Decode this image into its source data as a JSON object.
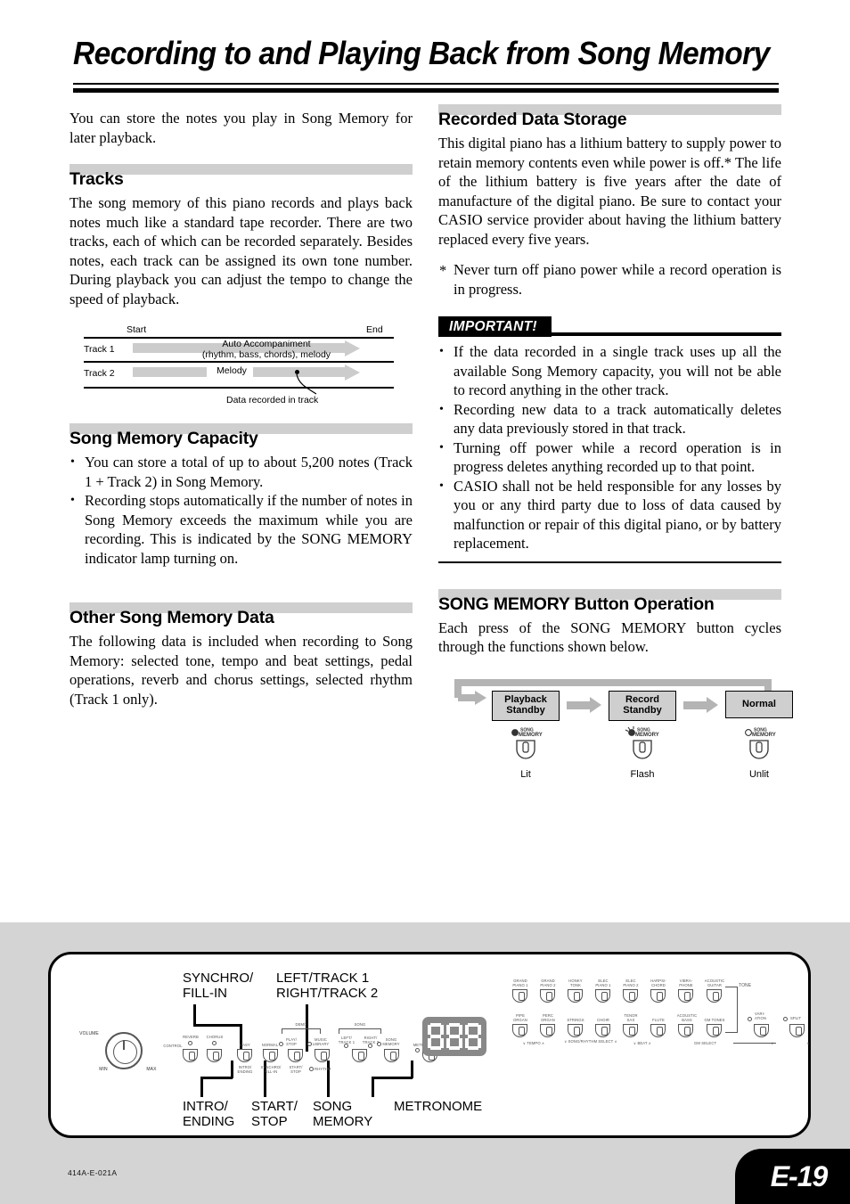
{
  "page": {
    "title": "Recording to and Playing Back from Song Memory",
    "footer_code": "414A-E-021A",
    "page_number": "E-19"
  },
  "intro": {
    "text": "You can store the notes you play in Song Memory for later playback."
  },
  "sections": {
    "tracks": {
      "heading": "Tracks",
      "body": "The song memory of this piano records and plays back notes much like a standard tape recorder. There are two tracks, each of which can be recorded separately. Besides notes, each track can be assigned its own tone number. During playback you can adjust the tempo to change the speed of playback."
    },
    "capacity": {
      "heading": "Song Memory Capacity",
      "bullets": [
        "You can store a total of up to about 5,200 notes (Track 1 + Track 2) in Song Memory.",
        "Recording stops automatically if the number of notes in Song Memory exceeds the maximum while you are recording. This is indicated by the SONG MEMORY indicator lamp turning on."
      ]
    },
    "other_data": {
      "heading": "Other Song Memory Data",
      "body": "The following data is included when recording to Song Memory: selected tone, tempo and beat settings, pedal operations, reverb and chorus settings, selected rhythm (Track 1 only)."
    },
    "storage": {
      "heading": "Recorded Data Storage",
      "body": "This digital piano has a lithium battery to supply power to retain memory contents even while power is off.* The life of the lithium battery is five years after the date of manufacture of the digital piano. Be sure to contact your CASIO service provider about having the lithium battery replaced every five years.",
      "footnote": "Never turn off piano power while a record operation is in progress."
    },
    "important": {
      "label": "IMPORTANT!",
      "bullets": [
        "If the data recorded in a single track uses up all the available Song Memory capacity, you will not be able to record anything in the other track.",
        "Recording new data to a track automatically deletes any data previously stored in that track.",
        "Turning off power while a record operation is in progress deletes anything recorded up to that point.",
        "CASIO shall not be held responsible for any losses by you or any third party due to loss of data caused by malfunction or repair of this digital piano, or by battery replacement."
      ]
    },
    "button_operation": {
      "heading": "SONG MEMORY Button Operation",
      "body": "Each press of the SONG MEMORY button cycles through the functions shown below."
    }
  },
  "track_diagram": {
    "start_label": "Start",
    "end_label": "End",
    "track1_label": "Track 1",
    "track2_label": "Track 2",
    "track1_content_line1": "Auto Accompaniment",
    "track1_content_line2": "(rhythm, bass, chords), melody",
    "track2_content": "Melody",
    "callout": "Data recorded in track"
  },
  "cycle_diagram": {
    "states": [
      {
        "line1": "Playback",
        "line2": "Standby",
        "lamp": "Lit",
        "button_label_line1": "SONG",
        "button_label_line2": "MEMORY"
      },
      {
        "line1": "Record",
        "line2": "Standby",
        "lamp": "Flash",
        "button_label_line1": "SONG",
        "button_label_line2": "MEMORY"
      },
      {
        "line1": "Normal",
        "line2": "",
        "lamp": "Unlit",
        "button_label_line1": "SONG",
        "button_label_line2": "MEMORY"
      }
    ]
  },
  "panel": {
    "callouts_top": [
      {
        "line1": "SYNCHRO/",
        "line2": "FILL-IN"
      },
      {
        "line1": "LEFT/TRACK 1",
        "line2": "RIGHT/TRACK 2"
      }
    ],
    "callouts_bottom": [
      {
        "line1": "INTRO/",
        "line2": "ENDING"
      },
      {
        "line1": "START/",
        "line2": "STOP"
      },
      {
        "line1": "SONG",
        "line2": "MEMORY"
      },
      {
        "line1": "METRONOME",
        "line2": ""
      }
    ],
    "volume": {
      "label": "VOLUME",
      "min": "MIN",
      "max": "MAX"
    },
    "display_value": "888",
    "left_buttons": [
      {
        "top": "CONTROL",
        "bottom": ""
      },
      {
        "top": "",
        "bottom": ""
      }
    ],
    "leds": [
      "REVERB",
      "CHORUS"
    ],
    "rhythm_buttons": [
      {
        "top": "EASY",
        "bottom_line1": "INTRO/",
        "bottom_line2": "ENDING"
      },
      {
        "top": "NORMAL",
        "bottom_line1": "SYNCHRO/",
        "bottom_line2": "FILL-IN"
      },
      {
        "top_line1": "PLAY/",
        "top_line2": "STOP",
        "bottom_line1": "START/",
        "bottom_line2": "STOP"
      },
      {
        "top_line1": "MUSIC",
        "top_line2": "LIBRARY",
        "bottom_line1": "RHYTHM",
        "bottom_line2": ""
      },
      {
        "top_line1": "LEFT/",
        "top_line2": "TRACK 1",
        "bottom_line1": "",
        "bottom_line2": ""
      },
      {
        "top_line1": "RIGHT/",
        "top_line2": "TRACK 2",
        "bottom_line1": "",
        "bottom_line2": ""
      },
      {
        "top_line1": "SONG",
        "top_line2": "MEMORY",
        "bottom_line1": "",
        "bottom_line2": ""
      },
      {
        "top_line1": "METRONOME",
        "top_line2": "",
        "bottom_line1": "",
        "bottom_line2": ""
      }
    ],
    "brackets": [
      "DEMO",
      "SONG"
    ],
    "tone_row1": [
      {
        "l1": "GRAND",
        "l2": "PIANO 1"
      },
      {
        "l1": "GRAND",
        "l2": "PIANO 2"
      },
      {
        "l1": "HONKY",
        "l2": "TONK"
      },
      {
        "l1": "ELEC",
        "l2": "PIANO 1"
      },
      {
        "l1": "ELEC",
        "l2": "PIANO 2"
      },
      {
        "l1": "HARPSI-",
        "l2": "CHORD"
      },
      {
        "l1": "VIBRA-",
        "l2": "PHONE"
      },
      {
        "l1": "ACOUSTIC",
        "l2": "GUITAR"
      }
    ],
    "tone_row2": [
      {
        "l1": "PIPE",
        "l2": "ORGAN"
      },
      {
        "l1": "PERC",
        "l2": "ORGAN"
      },
      {
        "l1": "STRINGS",
        "l2": ""
      },
      {
        "l1": "CHOIR",
        "l2": ""
      },
      {
        "l1": "TENOR",
        "l2": "SAX"
      },
      {
        "l1": "FLUTE",
        "l2": ""
      },
      {
        "l1": "ACOUSTIC",
        "l2": "BASS"
      },
      {
        "l1": "GM TONES",
        "l2": ""
      }
    ],
    "tone_group_label": "TONE",
    "under_labels": [
      "TEMPO",
      "SONG/RHYTHM SELECT",
      "BEAT",
      "GM SELECT"
    ],
    "right_buttons": [
      {
        "l1": "VARI-",
        "l2": "ATION"
      },
      {
        "l1": "SPLIT",
        "l2": ""
      }
    ]
  }
}
